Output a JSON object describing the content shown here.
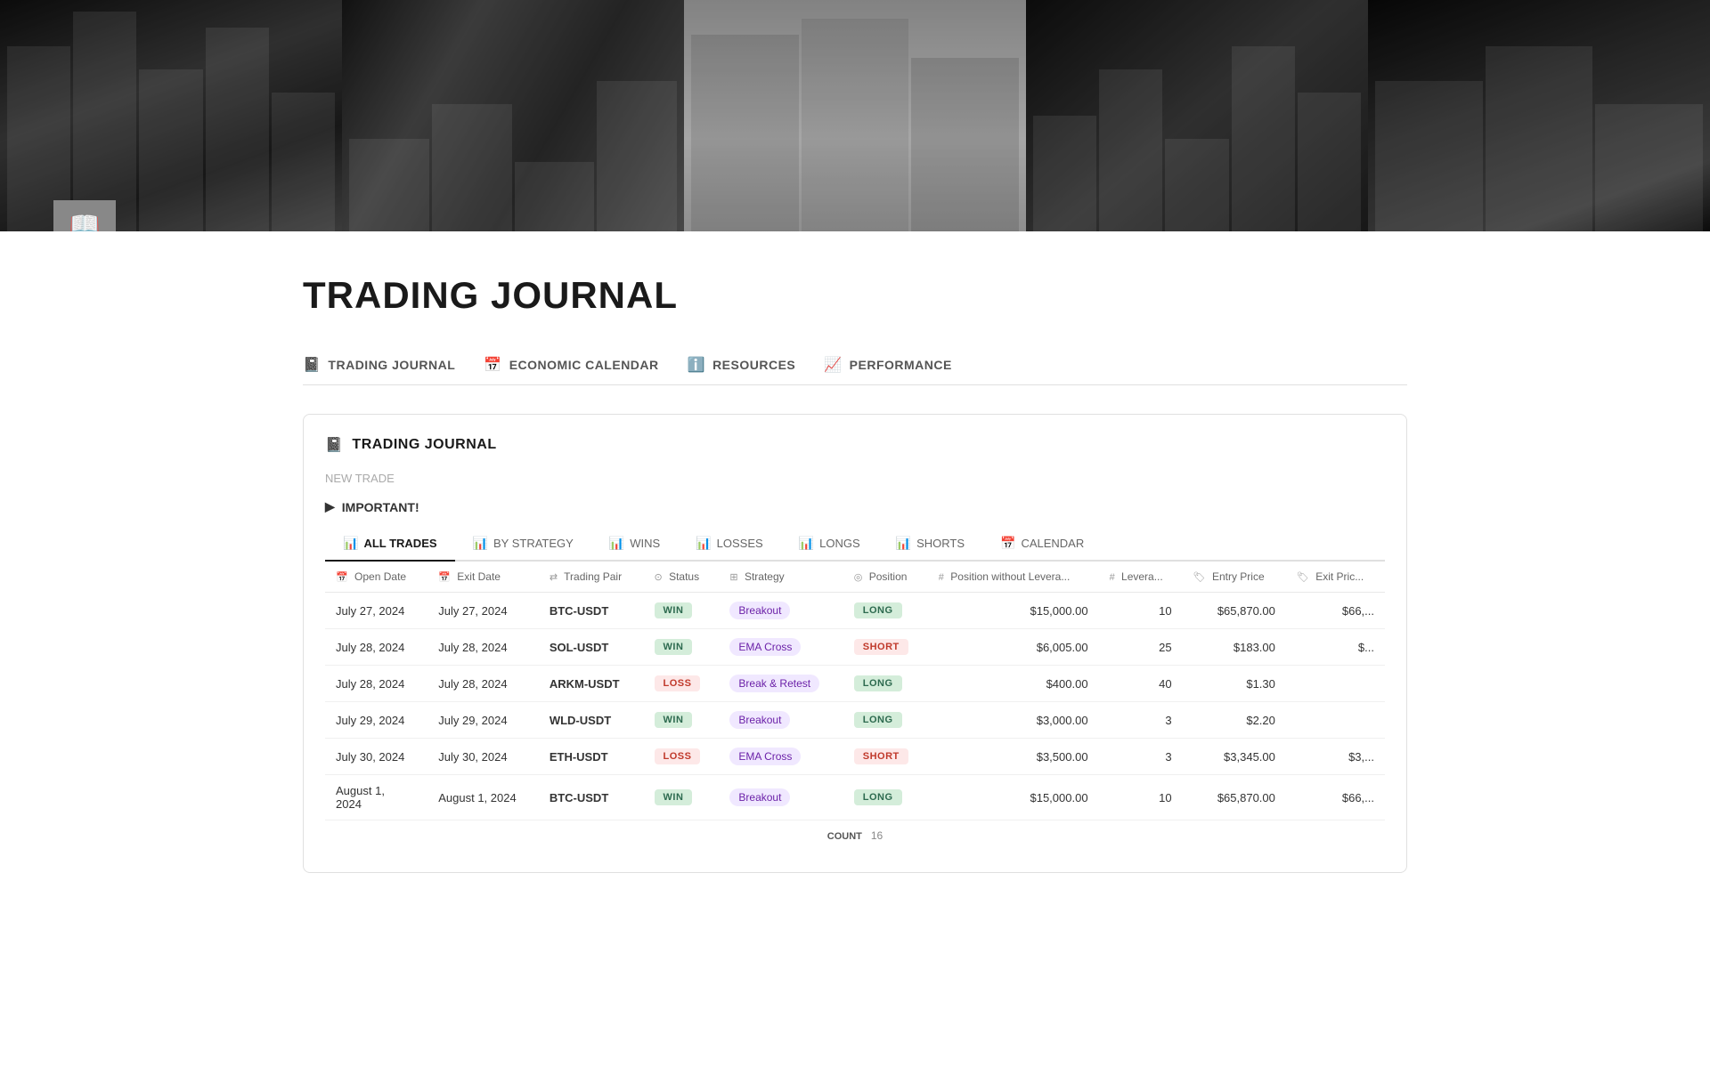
{
  "hero": {
    "panels": [
      {
        "label": "buildings-panel-1"
      },
      {
        "label": "trading-desk-panel"
      },
      {
        "label": "buildings-panel-2"
      },
      {
        "label": "chart-panel"
      },
      {
        "label": "mobile-trading-panel"
      }
    ],
    "icon": "📖"
  },
  "page": {
    "title": "TRADING JOURNAL"
  },
  "nav": {
    "tabs": [
      {
        "label": "TRADING JOURNAL",
        "icon": "📓",
        "name": "trading-journal-nav"
      },
      {
        "label": "ECONOMIC CALENDAR",
        "icon": "📅",
        "name": "economic-calendar-nav"
      },
      {
        "label": "RESOURCES",
        "icon": "ℹ️",
        "name": "resources-nav"
      },
      {
        "label": "PERFORMANCE",
        "icon": "📈",
        "name": "performance-nav"
      }
    ]
  },
  "journal": {
    "header": "TRADING JOURNAL",
    "header_icon": "📓",
    "new_trade_label": "NEW TRADE",
    "important_label": "IMPORTANT!",
    "view_tabs": [
      {
        "label": "ALL TRADES",
        "icon": "📊",
        "active": true
      },
      {
        "label": "BY STRATEGY",
        "icon": "📊",
        "active": false
      },
      {
        "label": "WINS",
        "icon": "📊",
        "active": false
      },
      {
        "label": "LOSSES",
        "icon": "📊",
        "active": false
      },
      {
        "label": "LONGS",
        "icon": "📊",
        "active": false
      },
      {
        "label": "SHORTS",
        "icon": "📊",
        "active": false
      },
      {
        "label": "CALENDAR",
        "icon": "📅",
        "active": false
      }
    ],
    "columns": [
      {
        "label": "Open Date",
        "icon": "📅"
      },
      {
        "label": "Exit Date",
        "icon": "📅"
      },
      {
        "label": "Trading Pair",
        "icon": "⇄"
      },
      {
        "label": "Status",
        "icon": "⊙"
      },
      {
        "label": "Strategy",
        "icon": "⊞"
      },
      {
        "label": "Position",
        "icon": "◎"
      },
      {
        "label": "Position without Levera...",
        "icon": "#"
      },
      {
        "label": "Levera...",
        "icon": "#"
      },
      {
        "label": "Entry Price",
        "icon": "🏷"
      },
      {
        "label": "Exit Pric...",
        "icon": "🏷"
      }
    ],
    "rows": [
      {
        "open_date": "July 27, 2024",
        "exit_date": "July 27, 2024",
        "trading_pair": "BTC-USDT",
        "status": "WIN",
        "strategy": "Breakout",
        "position": "LONG",
        "position_no_leverage": "$15,000.00",
        "leverage": "10",
        "entry_price": "$65,870.00",
        "exit_price": "$66,..."
      },
      {
        "open_date": "July 28, 2024",
        "exit_date": "July 28, 2024",
        "trading_pair": "SOL-USDT",
        "status": "WIN",
        "strategy": "EMA Cross",
        "position": "SHORT",
        "position_no_leverage": "$6,005.00",
        "leverage": "25",
        "entry_price": "$183.00",
        "exit_price": "$..."
      },
      {
        "open_date": "July 28, 2024",
        "exit_date": "July 28, 2024",
        "trading_pair": "ARKM-USDT",
        "status": "LOSS",
        "strategy": "Break & Retest",
        "position": "LONG",
        "position_no_leverage": "$400.00",
        "leverage": "40",
        "entry_price": "$1.30",
        "exit_price": ""
      },
      {
        "open_date": "July 29, 2024",
        "exit_date": "July 29, 2024",
        "trading_pair": "WLD-USDT",
        "status": "WIN",
        "strategy": "Breakout",
        "position": "LONG",
        "position_no_leverage": "$3,000.00",
        "leverage": "3",
        "entry_price": "$2.20",
        "exit_price": ""
      },
      {
        "open_date": "July 30, 2024",
        "exit_date": "July 30, 2024",
        "trading_pair": "ETH-USDT",
        "status": "LOSS",
        "strategy": "EMA Cross",
        "position": "SHORT",
        "position_no_leverage": "$3,500.00",
        "leverage": "3",
        "entry_price": "$3,345.00",
        "exit_price": "$3,..."
      },
      {
        "open_date": "August 1,\n2024",
        "exit_date": "August 1, 2024",
        "trading_pair": "BTC-USDT",
        "status": "WIN",
        "strategy": "Breakout",
        "position": "LONG",
        "position_no_leverage": "$15,000.00",
        "leverage": "10",
        "entry_price": "$65,870.00",
        "exit_price": "$66,..."
      }
    ],
    "count_label": "COUNT",
    "count_value": "16"
  }
}
